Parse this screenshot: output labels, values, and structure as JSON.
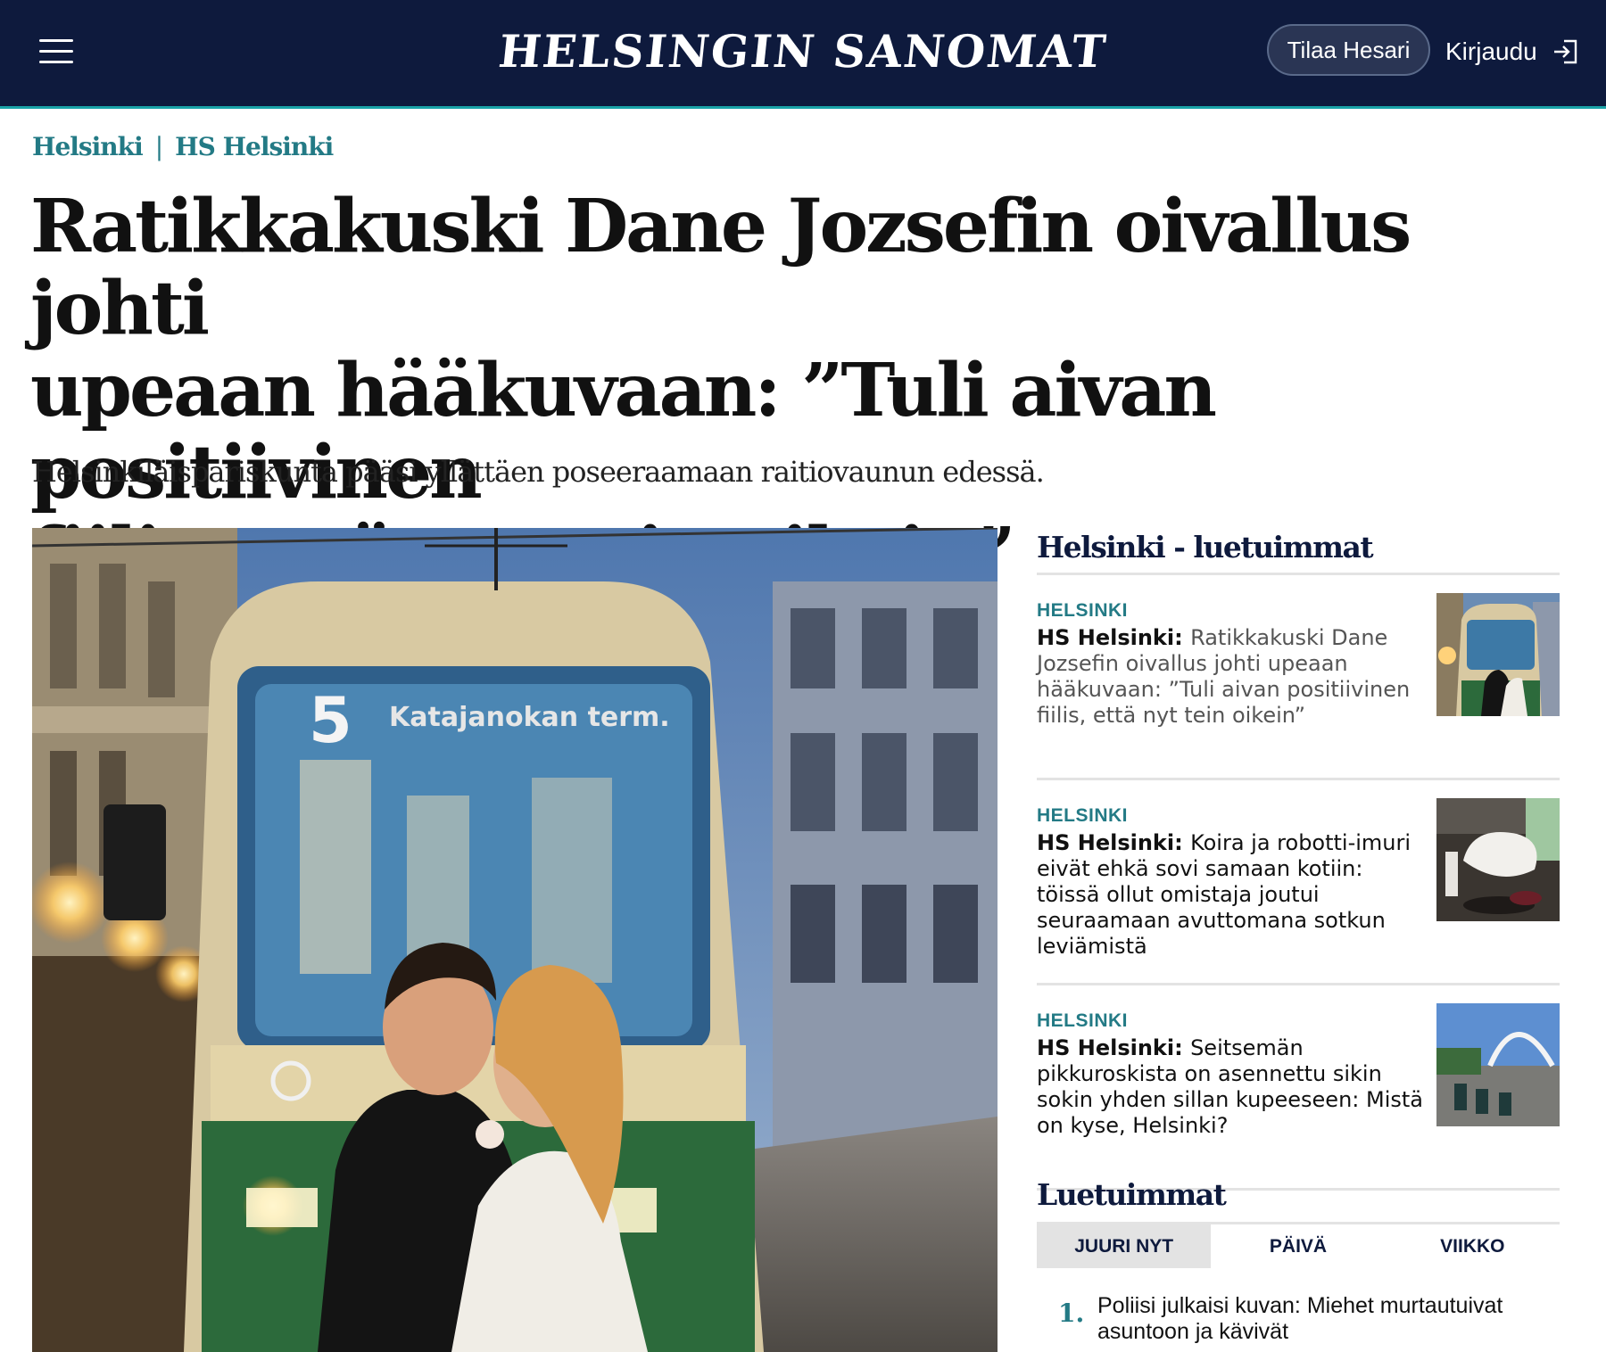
{
  "header": {
    "logo": "HELSINGIN SANOMAT",
    "subscribe_label": "Tilaa Hesari",
    "login_label": "Kirjaudu"
  },
  "breadcrumb": {
    "section": "Helsinki",
    "subsection": "HS Helsinki"
  },
  "article": {
    "headline_line1": "Ratikkakuski Dane Jozsefin oivallus johti",
    "headline_line2": "upeaan hääkuvaan: ”Tuli aivan positiivinen",
    "headline_line3": "fiilis, että nyt tein oikein”",
    "lede": "Helsinkiläispariskunta pääsi yllättäen poseeraamaan raitiovaunun edessä.",
    "tram_number": "5",
    "tram_destination": "Katajanokan term."
  },
  "sidebar": {
    "title": "Helsinki - luetuimmat",
    "items": [
      {
        "category": "HELSINKI",
        "prefix": "HS Helsinki:",
        "text": "Ratikkakuski Dane Jozsefin oivallus johti upeaan hääkuvaan: ”Tuli aivan positiivinen fiilis, että nyt tein oikein”"
      },
      {
        "category": "HELSINKI",
        "prefix": "HS Helsinki:",
        "text": "Koira ja robotti-imuri eivät ehkä sovi samaan kotiin: töissä ollut omistaja joutui seuraamaan avuttomana sotkun leviämistä"
      },
      {
        "category": "HELSINKI",
        "prefix": "HS Helsinki:",
        "text": "Seitsemän pikkuroskista on asennettu sikin sokin yhden sillan kupeeseen: Mistä on kyse, Helsinki?"
      }
    ]
  },
  "most_read": {
    "title": "Luetuimmat",
    "tabs": [
      "JUURI NYT",
      "PÄIVÄ",
      "VIIKKO"
    ],
    "first_rank": "1.",
    "first_text": "Poliisi julkaisi kuvan: Miehet murtautuivat asuntoon ja kävivät"
  },
  "colors": {
    "header_bg": "#0e1a3d",
    "accent_teal": "#237a85",
    "divider": "#e3e3e3"
  }
}
